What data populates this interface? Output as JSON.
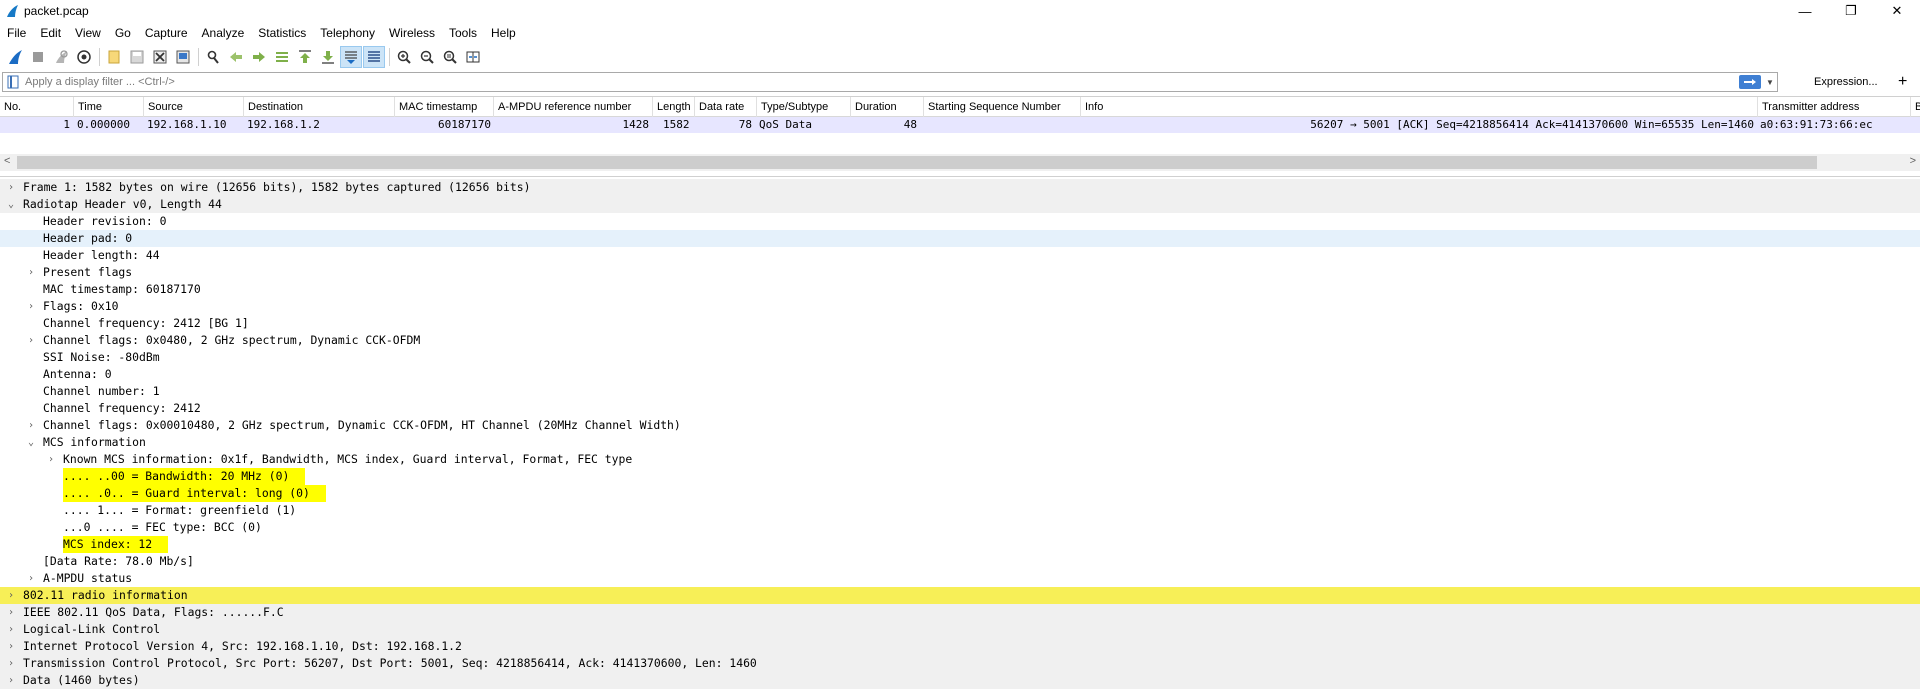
{
  "window": {
    "title": "packet.pcap",
    "controls": [
      "—",
      "❐",
      "✕"
    ]
  },
  "menu": [
    "File",
    "Edit",
    "View",
    "Go",
    "Capture",
    "Analyze",
    "Statistics",
    "Telephony",
    "Wireless",
    "Tools",
    "Help"
  ],
  "toolbar": {
    "icons": [
      "start-capture-icon",
      "stop-capture-icon",
      "restart-capture-icon",
      "capture-options-icon",
      "open-file-icon",
      "save-file-icon",
      "close-file-icon",
      "reload-file-icon",
      "find-packet-icon",
      "go-back-icon",
      "go-forward-icon",
      "go-to-packet-icon",
      "go-first-icon",
      "go-last-icon",
      "autoscroll-icon",
      "colorize-icon",
      "zoom-in-icon",
      "zoom-out-icon",
      "normal-size-icon",
      "resize-columns-icon"
    ]
  },
  "filter": {
    "placeholder": "Apply a display filter ... <Ctrl-/>",
    "expression_label": "Expression...",
    "plus_label": "+"
  },
  "packet_list": {
    "columns": [
      "No.",
      "Time",
      "Source",
      "Destination",
      "MAC timestamp",
      "A-MPDU reference number",
      "Length",
      "Data rate",
      "Type/Subtype",
      "Duration",
      "Starting Sequence Number",
      "Info",
      "Transmitter address",
      "Bl"
    ],
    "rows": [
      {
        "no": "1",
        "time": "0.000000",
        "source": "192.168.1.10",
        "destination": "192.168.1.2",
        "mac_timestamp": "60187170",
        "ampdu_ref": "1428",
        "length": "1582",
        "data_rate": "78",
        "type_subtype": "QoS Data",
        "duration": "48",
        "start_seq": "",
        "info": "56207 → 5001 [ACK] Seq=4218856414 Ack=4141370600 Win=65535 Len=1460",
        "transmitter": "a0:63:91:73:66:ec"
      }
    ]
  },
  "details": [
    {
      "text": "Frame 1: 1582 bytes on wire (12656 bits), 1582 bytes captured (12656 bits)",
      "level": 0,
      "expander": "collapsed",
      "style": "gray"
    },
    {
      "text": "Radiotap Header v0, Length 44",
      "level": 0,
      "expander": "expanded",
      "style": "gray"
    },
    {
      "text": "Header revision: 0",
      "level": 1,
      "expander": "none",
      "style": ""
    },
    {
      "text": "Header pad: 0",
      "level": 1,
      "expander": "none",
      "style": "sel"
    },
    {
      "text": "Header length: 44",
      "level": 1,
      "expander": "none",
      "style": ""
    },
    {
      "text": "Present flags",
      "level": 1,
      "expander": "collapsed",
      "style": ""
    },
    {
      "text": "MAC timestamp: 60187170",
      "level": 1,
      "expander": "none",
      "style": ""
    },
    {
      "text": "Flags: 0x10",
      "level": 1,
      "expander": "collapsed",
      "style": ""
    },
    {
      "text": "Channel frequency: 2412 [BG 1]",
      "level": 1,
      "expander": "none",
      "style": ""
    },
    {
      "text": "Channel flags: 0x0480, 2 GHz spectrum, Dynamic CCK-OFDM",
      "level": 1,
      "expander": "collapsed",
      "style": ""
    },
    {
      "text": "SSI Noise: -80dBm",
      "level": 1,
      "expander": "none",
      "style": ""
    },
    {
      "text": "Antenna: 0",
      "level": 1,
      "expander": "none",
      "style": ""
    },
    {
      "text": "Channel number: 1",
      "level": 1,
      "expander": "none",
      "style": ""
    },
    {
      "text": "Channel frequency: 2412",
      "level": 1,
      "expander": "none",
      "style": ""
    },
    {
      "text": "Channel flags: 0x00010480, 2 GHz spectrum, Dynamic CCK-OFDM, HT Channel (20MHz Channel Width)",
      "level": 1,
      "expander": "collapsed",
      "style": ""
    },
    {
      "text": "MCS information",
      "level": 1,
      "expander": "expanded",
      "style": ""
    },
    {
      "text": "Known MCS information: 0x1f, Bandwidth, MCS index, Guard interval, Format, FEC type",
      "level": 2,
      "expander": "collapsed",
      "style": ""
    },
    {
      "text": ".... ..00 = Bandwidth: 20 MHz (0)",
      "level": 2,
      "expander": "none",
      "style": "hl"
    },
    {
      "text": ".... .0.. = Guard interval: long (0)",
      "level": 2,
      "expander": "none",
      "style": "hl"
    },
    {
      "text": ".... 1... = Format: greenfield (1)",
      "level": 2,
      "expander": "none",
      "style": ""
    },
    {
      "text": "...0 .... = FEC type: BCC (0)",
      "level": 2,
      "expander": "none",
      "style": ""
    },
    {
      "text": "MCS index: 12",
      "level": 2,
      "expander": "none",
      "style": "hl"
    },
    {
      "text": "[Data Rate: 78.0 Mb/s]",
      "level": 1,
      "expander": "none",
      "style": ""
    },
    {
      "text": "A-MPDU status",
      "level": 1,
      "expander": "collapsed",
      "style": ""
    },
    {
      "text": "802.11 radio information",
      "level": 0,
      "expander": "collapsed",
      "style": "yellow"
    },
    {
      "text": "IEEE 802.11 QoS Data, Flags: ......F.C",
      "level": 0,
      "expander": "collapsed",
      "style": "gray"
    },
    {
      "text": "Logical-Link Control",
      "level": 0,
      "expander": "collapsed",
      "style": "gray"
    },
    {
      "text": "Internet Protocol Version 4, Src: 192.168.1.10, Dst: 192.168.1.2",
      "level": 0,
      "expander": "collapsed",
      "style": "gray"
    },
    {
      "text": "Transmission Control Protocol, Src Port: 56207, Dst Port: 5001, Seq: 4218856414, Ack: 4141370600, Len: 1460",
      "level": 0,
      "expander": "collapsed",
      "style": "gray"
    },
    {
      "text": "Data (1460 bytes)",
      "level": 0,
      "expander": "collapsed",
      "style": "gray"
    }
  ],
  "colors": {
    "selected_row": "#e7e6ff",
    "field_highlight": "#ffff00",
    "section_highlight": "#f7ef57",
    "tree_selection": "#e5f1fb",
    "section_bg": "#f0f0f0"
  }
}
